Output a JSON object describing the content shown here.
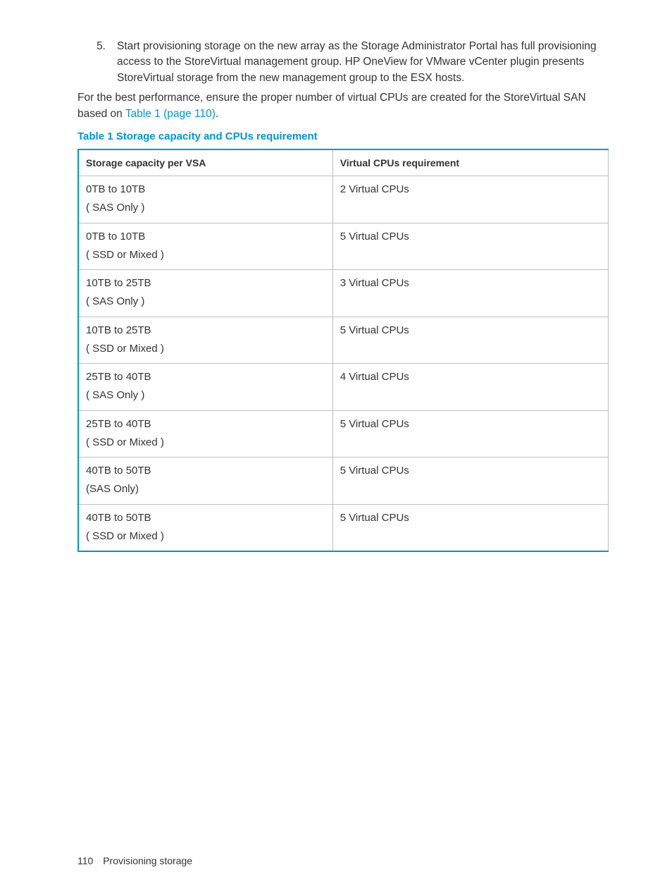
{
  "list_item": {
    "number": "5.",
    "text": "Start provisioning storage on the new array as the Storage Administrator Portal has full provisioning access to the StoreVirtual management group. HP OneView for VMware vCenter plugin presents StoreVirtual storage from the new management group to the ESX hosts."
  },
  "paragraph": {
    "pre_link": "For the best performance, ensure the proper number of virtual CPUs are created for the StoreVirtual SAN based on ",
    "link": "Table 1 (page 110)",
    "post_link": "."
  },
  "table": {
    "caption": "Table 1 Storage capacity and CPUs requirement",
    "headers": {
      "col1": "Storage capacity per VSA",
      "col2": "Virtual CPUs requirement"
    },
    "rows": [
      {
        "c1l1": "0TB to 10TB",
        "c1l2": "( SAS Only )",
        "c2": "2 Virtual CPUs"
      },
      {
        "c1l1": "0TB to 10TB",
        "c1l2": "( SSD or Mixed )",
        "c2": "5 Virtual CPUs"
      },
      {
        "c1l1": "10TB to 25TB",
        "c1l2": "( SAS Only )",
        "c2": "3 Virtual CPUs"
      },
      {
        "c1l1": "10TB to 25TB",
        "c1l2": "( SSD or Mixed )",
        "c2": "5 Virtual CPUs"
      },
      {
        "c1l1": "25TB to 40TB",
        "c1l2": "( SAS Only )",
        "c2": "4 Virtual CPUs"
      },
      {
        "c1l1": "25TB to 40TB",
        "c1l2": "( SSD or Mixed )",
        "c2": "5 Virtual CPUs"
      },
      {
        "c1l1": "40TB to 50TB",
        "c1l2": "(SAS Only)",
        "c2": "5 Virtual CPUs"
      },
      {
        "c1l1": "40TB to 50TB",
        "c1l2": "( SSD or Mixed )",
        "c2": "5 Virtual CPUs"
      }
    ]
  },
  "footer": {
    "page": "110",
    "section": "Provisioning storage"
  }
}
